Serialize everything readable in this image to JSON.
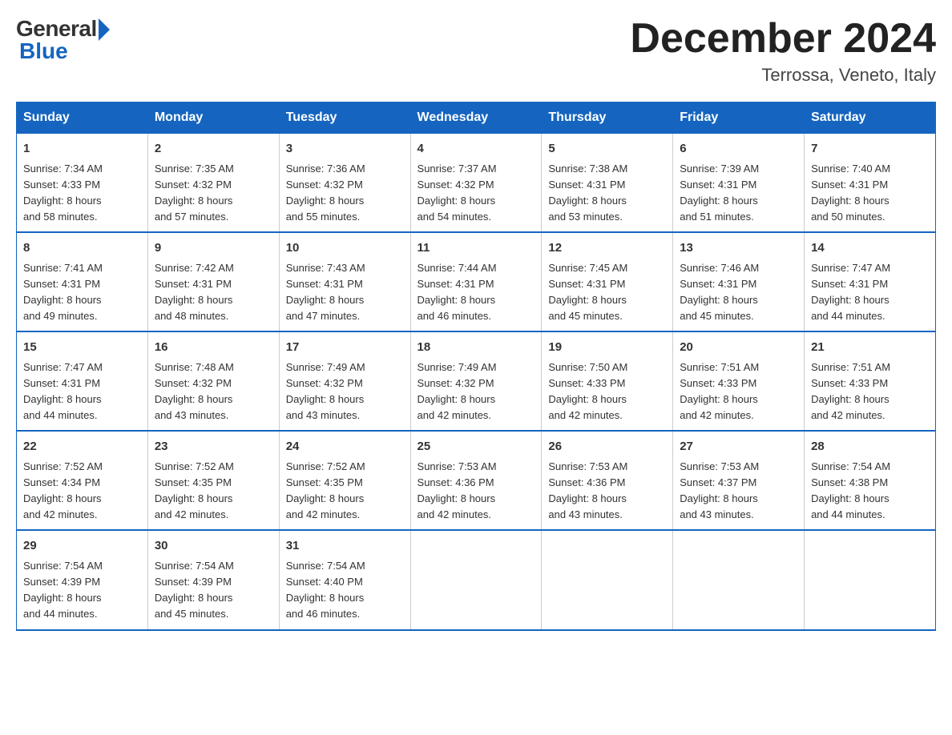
{
  "logo": {
    "general": "General",
    "blue": "Blue"
  },
  "header": {
    "month": "December 2024",
    "location": "Terrossa, Veneto, Italy"
  },
  "weekdays": [
    "Sunday",
    "Monday",
    "Tuesday",
    "Wednesday",
    "Thursday",
    "Friday",
    "Saturday"
  ],
  "weeks": [
    [
      {
        "day": "1",
        "sunrise": "7:34 AM",
        "sunset": "4:33 PM",
        "daylight": "8 hours and 58 minutes."
      },
      {
        "day": "2",
        "sunrise": "7:35 AM",
        "sunset": "4:32 PM",
        "daylight": "8 hours and 57 minutes."
      },
      {
        "day": "3",
        "sunrise": "7:36 AM",
        "sunset": "4:32 PM",
        "daylight": "8 hours and 55 minutes."
      },
      {
        "day": "4",
        "sunrise": "7:37 AM",
        "sunset": "4:32 PM",
        "daylight": "8 hours and 54 minutes."
      },
      {
        "day": "5",
        "sunrise": "7:38 AM",
        "sunset": "4:31 PM",
        "daylight": "8 hours and 53 minutes."
      },
      {
        "day": "6",
        "sunrise": "7:39 AM",
        "sunset": "4:31 PM",
        "daylight": "8 hours and 51 minutes."
      },
      {
        "day": "7",
        "sunrise": "7:40 AM",
        "sunset": "4:31 PM",
        "daylight": "8 hours and 50 minutes."
      }
    ],
    [
      {
        "day": "8",
        "sunrise": "7:41 AM",
        "sunset": "4:31 PM",
        "daylight": "8 hours and 49 minutes."
      },
      {
        "day": "9",
        "sunrise": "7:42 AM",
        "sunset": "4:31 PM",
        "daylight": "8 hours and 48 minutes."
      },
      {
        "day": "10",
        "sunrise": "7:43 AM",
        "sunset": "4:31 PM",
        "daylight": "8 hours and 47 minutes."
      },
      {
        "day": "11",
        "sunrise": "7:44 AM",
        "sunset": "4:31 PM",
        "daylight": "8 hours and 46 minutes."
      },
      {
        "day": "12",
        "sunrise": "7:45 AM",
        "sunset": "4:31 PM",
        "daylight": "8 hours and 45 minutes."
      },
      {
        "day": "13",
        "sunrise": "7:46 AM",
        "sunset": "4:31 PM",
        "daylight": "8 hours and 45 minutes."
      },
      {
        "day": "14",
        "sunrise": "7:47 AM",
        "sunset": "4:31 PM",
        "daylight": "8 hours and 44 minutes."
      }
    ],
    [
      {
        "day": "15",
        "sunrise": "7:47 AM",
        "sunset": "4:31 PM",
        "daylight": "8 hours and 44 minutes."
      },
      {
        "day": "16",
        "sunrise": "7:48 AM",
        "sunset": "4:32 PM",
        "daylight": "8 hours and 43 minutes."
      },
      {
        "day": "17",
        "sunrise": "7:49 AM",
        "sunset": "4:32 PM",
        "daylight": "8 hours and 43 minutes."
      },
      {
        "day": "18",
        "sunrise": "7:49 AM",
        "sunset": "4:32 PM",
        "daylight": "8 hours and 42 minutes."
      },
      {
        "day": "19",
        "sunrise": "7:50 AM",
        "sunset": "4:33 PM",
        "daylight": "8 hours and 42 minutes."
      },
      {
        "day": "20",
        "sunrise": "7:51 AM",
        "sunset": "4:33 PM",
        "daylight": "8 hours and 42 minutes."
      },
      {
        "day": "21",
        "sunrise": "7:51 AM",
        "sunset": "4:33 PM",
        "daylight": "8 hours and 42 minutes."
      }
    ],
    [
      {
        "day": "22",
        "sunrise": "7:52 AM",
        "sunset": "4:34 PM",
        "daylight": "8 hours and 42 minutes."
      },
      {
        "day": "23",
        "sunrise": "7:52 AM",
        "sunset": "4:35 PM",
        "daylight": "8 hours and 42 minutes."
      },
      {
        "day": "24",
        "sunrise": "7:52 AM",
        "sunset": "4:35 PM",
        "daylight": "8 hours and 42 minutes."
      },
      {
        "day": "25",
        "sunrise": "7:53 AM",
        "sunset": "4:36 PM",
        "daylight": "8 hours and 42 minutes."
      },
      {
        "day": "26",
        "sunrise": "7:53 AM",
        "sunset": "4:36 PM",
        "daylight": "8 hours and 43 minutes."
      },
      {
        "day": "27",
        "sunrise": "7:53 AM",
        "sunset": "4:37 PM",
        "daylight": "8 hours and 43 minutes."
      },
      {
        "day": "28",
        "sunrise": "7:54 AM",
        "sunset": "4:38 PM",
        "daylight": "8 hours and 44 minutes."
      }
    ],
    [
      {
        "day": "29",
        "sunrise": "7:54 AM",
        "sunset": "4:39 PM",
        "daylight": "8 hours and 44 minutes."
      },
      {
        "day": "30",
        "sunrise": "7:54 AM",
        "sunset": "4:39 PM",
        "daylight": "8 hours and 45 minutes."
      },
      {
        "day": "31",
        "sunrise": "7:54 AM",
        "sunset": "4:40 PM",
        "daylight": "8 hours and 46 minutes."
      },
      null,
      null,
      null,
      null
    ]
  ]
}
